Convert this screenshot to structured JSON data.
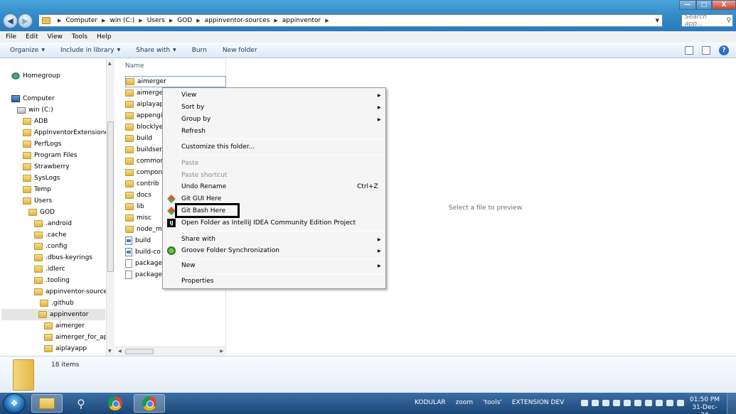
{
  "address": {
    "crumbs": [
      "Computer",
      "win (C:)",
      "Users",
      "GOD",
      "appinventor-sources",
      "appinventor"
    ],
    "search_placeholder": "Search app..."
  },
  "window_controls": {
    "minimize": "—",
    "maximize": "□",
    "close": "X"
  },
  "menubar": [
    "File",
    "Edit",
    "View",
    "Tools",
    "Help"
  ],
  "toolbar": {
    "organize": "Organize",
    "include_in_library": "Include in library",
    "share_with": "Share with",
    "burn": "Burn",
    "new_folder": "New folder"
  },
  "nav_pane": {
    "homegroup": "Homegroup",
    "computer": "Computer",
    "drive": "win (C:)",
    "items": [
      "ADB",
      "AppInventorExtensiones",
      "PerfLogs",
      "Program Files",
      "Strawberry",
      "SysLogs",
      "Temp",
      "Users",
      "GOD",
      ".android",
      ".cache",
      ".config",
      ".dbus-keyrings",
      ".idlerc",
      ".tooling",
      "appinventor-sources",
      ".github",
      "appinventor",
      "aimerger",
      "aimerger_for_appi",
      "aiplayapp"
    ]
  },
  "file_list": {
    "column_name": "Name",
    "items": [
      {
        "name": "aimerger",
        "type": "folder"
      },
      {
        "name": "aimerger",
        "type": "folder"
      },
      {
        "name": "aiplayapp",
        "type": "folder"
      },
      {
        "name": "appengin",
        "type": "folder"
      },
      {
        "name": "blocklyed",
        "type": "folder"
      },
      {
        "name": "build",
        "type": "folder"
      },
      {
        "name": "buildserv",
        "type": "folder"
      },
      {
        "name": "common",
        "type": "folder"
      },
      {
        "name": "compon",
        "type": "folder"
      },
      {
        "name": "contrib",
        "type": "folder"
      },
      {
        "name": "docs",
        "type": "folder"
      },
      {
        "name": "lib",
        "type": "folder"
      },
      {
        "name": "misc",
        "type": "folder"
      },
      {
        "name": "node_mo",
        "type": "folder"
      },
      {
        "name": "build",
        "type": "bat"
      },
      {
        "name": "build-co",
        "type": "bat"
      },
      {
        "name": "package.",
        "type": "doc"
      },
      {
        "name": "package-",
        "type": "doc"
      }
    ]
  },
  "context_menu": {
    "view": "View",
    "sort_by": "Sort by",
    "group_by": "Group by",
    "refresh": "Refresh",
    "customize": "Customize this folder...",
    "paste": "Paste",
    "paste_shortcut": "Paste shortcut",
    "undo_rename": "Undo Rename",
    "undo_shortcut": "Ctrl+Z",
    "git_gui": "Git GUI Here",
    "git_bash": "Git Bash Here",
    "open_intellij": "Open Folder as IntelliJ IDEA Community Edition Project",
    "intellij_icon_text": "IJ",
    "share_with": "Share with",
    "groove": "Groove Folder Synchronization",
    "new": "New",
    "properties": "Properties"
  },
  "preview": {
    "message": "Select a file to preview."
  },
  "details": {
    "item_count": "18 items"
  },
  "taskbar": {
    "tray_labels": [
      "KODULAR",
      "zoom",
      "'tools'",
      "EXTENSION DEV"
    ],
    "time": "01:50 PM",
    "date": "31-Dec-20"
  }
}
